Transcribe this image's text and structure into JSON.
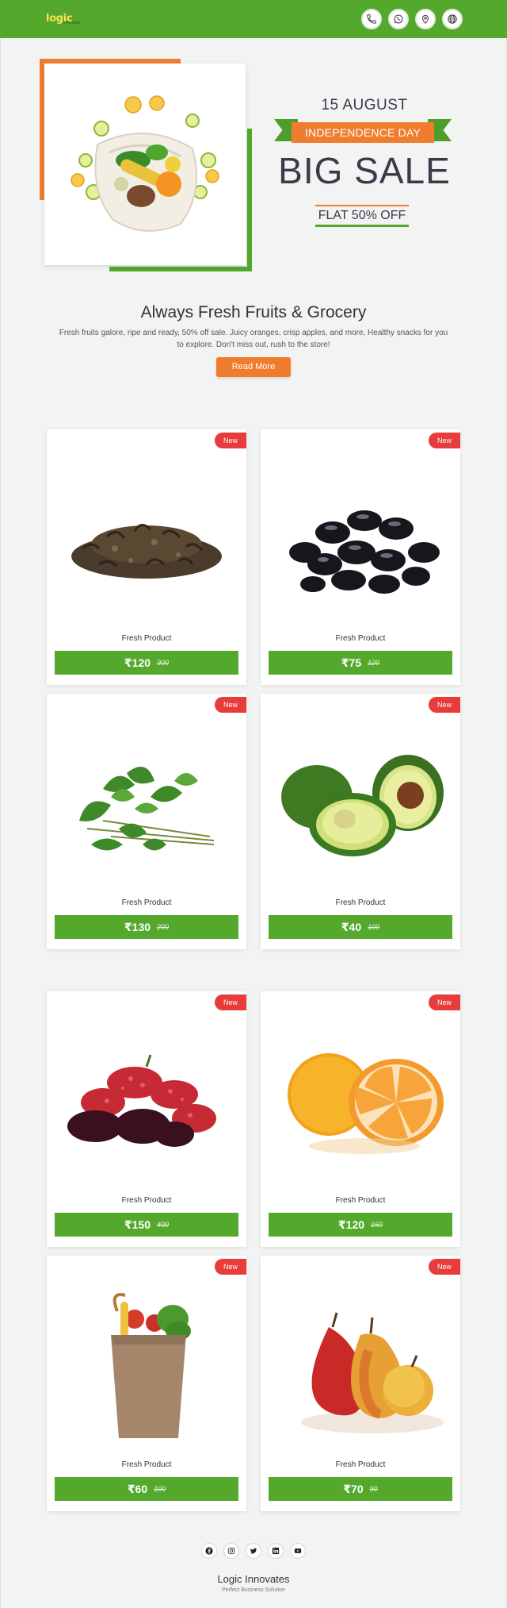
{
  "brand": {
    "logo_text": "logic",
    "logo_sub": "innovates",
    "name": "Logic Innovates",
    "tagline": "Perfect Business Solution",
    "accent": "#54a92c",
    "orange": "#f07d2e",
    "badge_red": "#e83b3b"
  },
  "header": {
    "icons": [
      "phone-icon",
      "whatsapp-icon",
      "location-pin-icon",
      "globe-icon"
    ]
  },
  "hero": {
    "date": "15 AUGUST",
    "ribbon": "INDEPENDENCE DAY",
    "headline": "BIG SALE",
    "offer": "FLAT 50% OFF"
  },
  "intro": {
    "title": "Always Fresh Fruits & Grocery",
    "text": "Fresh fruits galore, ripe and ready, 50% off sale. Juicy oranges, crisp apples, and more, Healthy snacks for you to explore. Don't miss out, rush to the store!",
    "button": "Read More"
  },
  "products": [
    {
      "badge": "New",
      "name": "Fresh Product",
      "price": "₹120",
      "old_price": "300",
      "image": "dried-tea-leaves"
    },
    {
      "badge": "New",
      "name": "Fresh Product",
      "price": "₹75",
      "old_price": "120",
      "image": "black-beans"
    },
    {
      "badge": "New",
      "name": "Fresh Product",
      "price": "₹130",
      "old_price": "200",
      "image": "leafy-greens"
    },
    {
      "badge": "New",
      "name": "Fresh Product",
      "price": "₹40",
      "old_price": "100",
      "image": "avocados"
    },
    {
      "badge": "New",
      "name": "Fresh Product",
      "price": "₹150",
      "old_price": "400",
      "image": "mulberries"
    },
    {
      "badge": "New",
      "name": "Fresh Product",
      "price": "₹120",
      "old_price": "160",
      "image": "oranges"
    },
    {
      "badge": "New",
      "name": "Fresh Product",
      "price": "₹60",
      "old_price": "100",
      "image": "grocery-bag"
    },
    {
      "badge": "New",
      "name": "Fresh Product",
      "price": "₹70",
      "old_price": "90",
      "image": "pears"
    }
  ],
  "footer": {
    "social_icons": [
      "facebook-icon",
      "instagram-icon",
      "twitter-icon",
      "linkedin-icon",
      "youtube-icon"
    ]
  }
}
